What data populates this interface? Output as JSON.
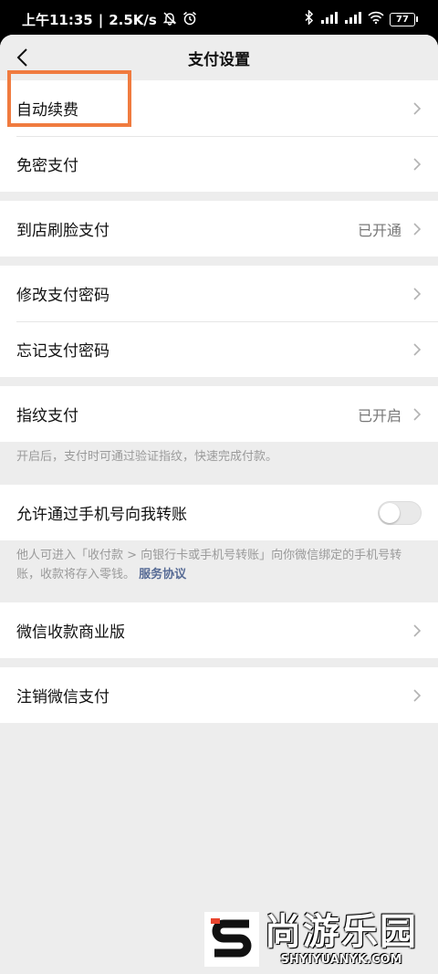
{
  "status_bar": {
    "time": "上午11:35",
    "speed": "2.5K/s",
    "battery": "77"
  },
  "nav": {
    "title": "支付设置"
  },
  "groups": [
    {
      "items": [
        {
          "label": "自动续费"
        },
        {
          "label": "免密支付"
        }
      ]
    },
    {
      "items": [
        {
          "label": "到店刷脸支付",
          "value": "已开通"
        }
      ]
    },
    {
      "items": [
        {
          "label": "修改支付密码"
        },
        {
          "label": "忘记支付密码"
        }
      ]
    },
    {
      "items": [
        {
          "label": "指纹支付",
          "value": "已开启"
        }
      ],
      "hint": "开启后，支付时可通过验证指纹，快速完成付款。"
    },
    {
      "items": [
        {
          "label": "允许通过手机号向我转账"
        }
      ],
      "hint": "他人可进入「收付款 > 向银行卡或手机号转账」向你微信绑定的手机号转账，收款将存入零钱。",
      "hint_link": "服务协议"
    },
    {
      "items": [
        {
          "label": "微信收款商业版"
        }
      ]
    },
    {
      "items": [
        {
          "label": "注销微信支付"
        }
      ]
    }
  ],
  "watermark": {
    "brand": "尚游乐园",
    "domain": "SHYIYUANYK.COM"
  },
  "colors": {
    "highlight": "#f07b3f",
    "link": "#576b95",
    "background": "#ededed"
  }
}
